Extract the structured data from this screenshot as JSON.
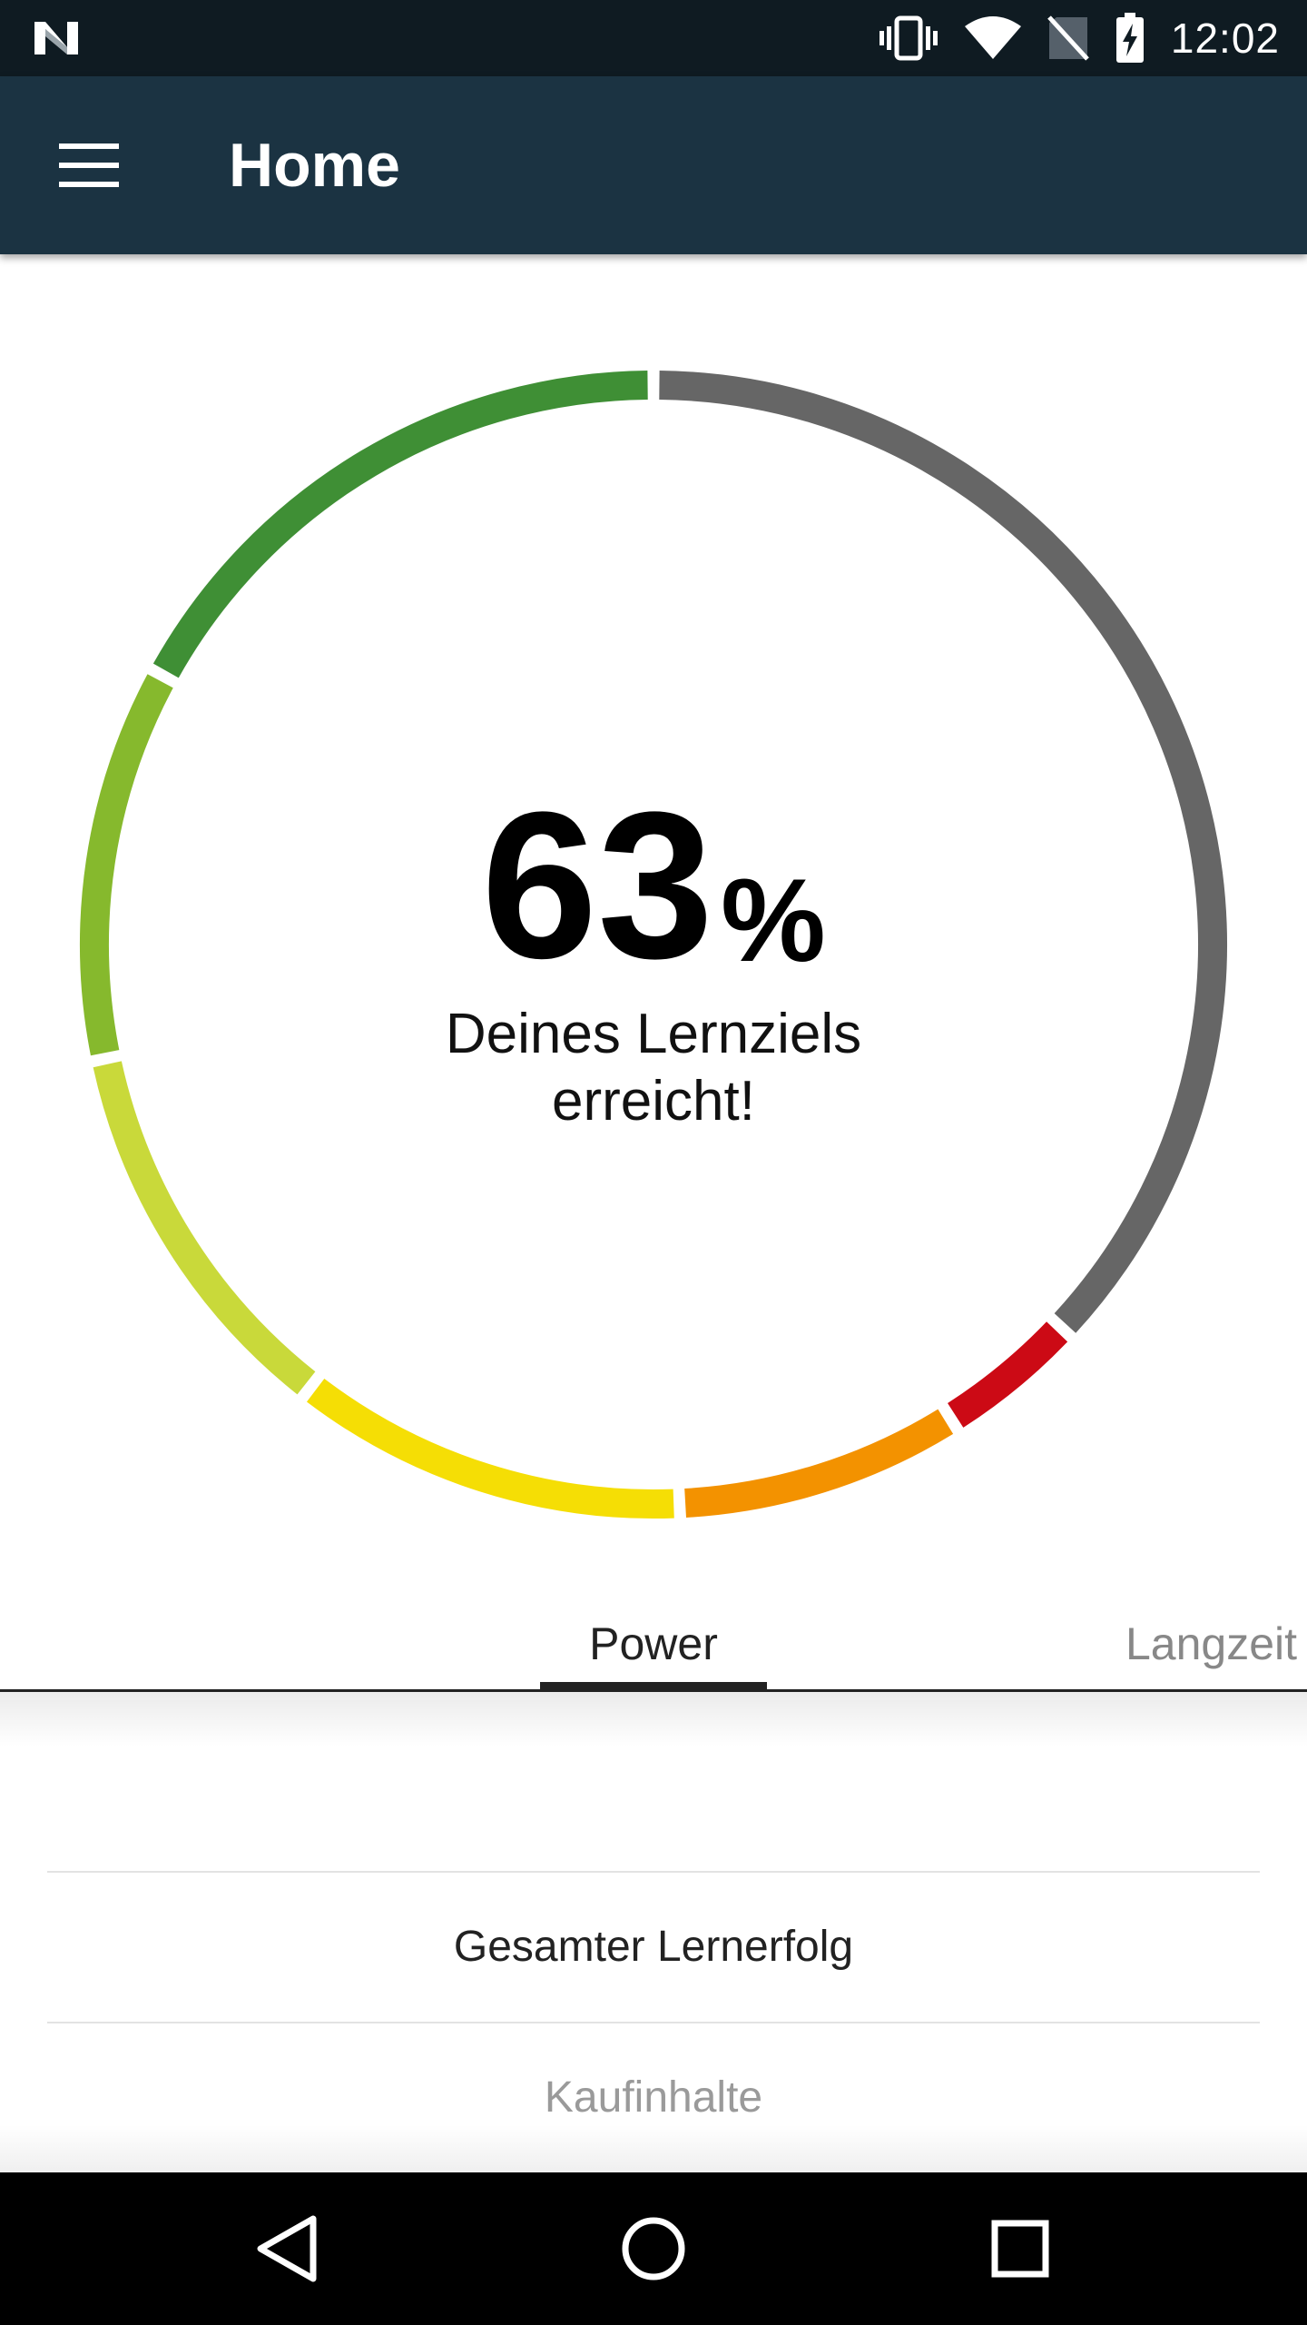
{
  "status_bar": {
    "time": "12:02",
    "left_icon": "n-logo-icon",
    "right_icons": [
      "vibrate-icon",
      "wifi-icon",
      "no-sim-icon",
      "battery-charging-icon"
    ]
  },
  "app_bar": {
    "title": "Home",
    "menu_icon": "hamburger-menu-icon"
  },
  "gauge": {
    "percent_value": "63",
    "percent_sign": "%",
    "caption_line1": "Deines Lernziels",
    "caption_line2": "erreicht!",
    "progress": 0.63,
    "segments": [
      {
        "color": "#3f8f35"
      },
      {
        "color": "#86b92d"
      },
      {
        "color": "#c9d93a"
      },
      {
        "color": "#f5de05"
      },
      {
        "color": "#f39200"
      },
      {
        "color": "#cc0a15"
      }
    ],
    "remaining_color": "#666666"
  },
  "tabs": [
    {
      "label": "Power",
      "selected": true
    },
    {
      "label": "Langzeit",
      "selected": false
    }
  ],
  "list": {
    "items": [
      {
        "label": "Gesamter Lernerfolg"
      },
      {
        "label": "Kaufinhalte"
      }
    ]
  },
  "nav_bar": {
    "icons": [
      "back-icon",
      "home-icon",
      "recents-icon"
    ]
  }
}
